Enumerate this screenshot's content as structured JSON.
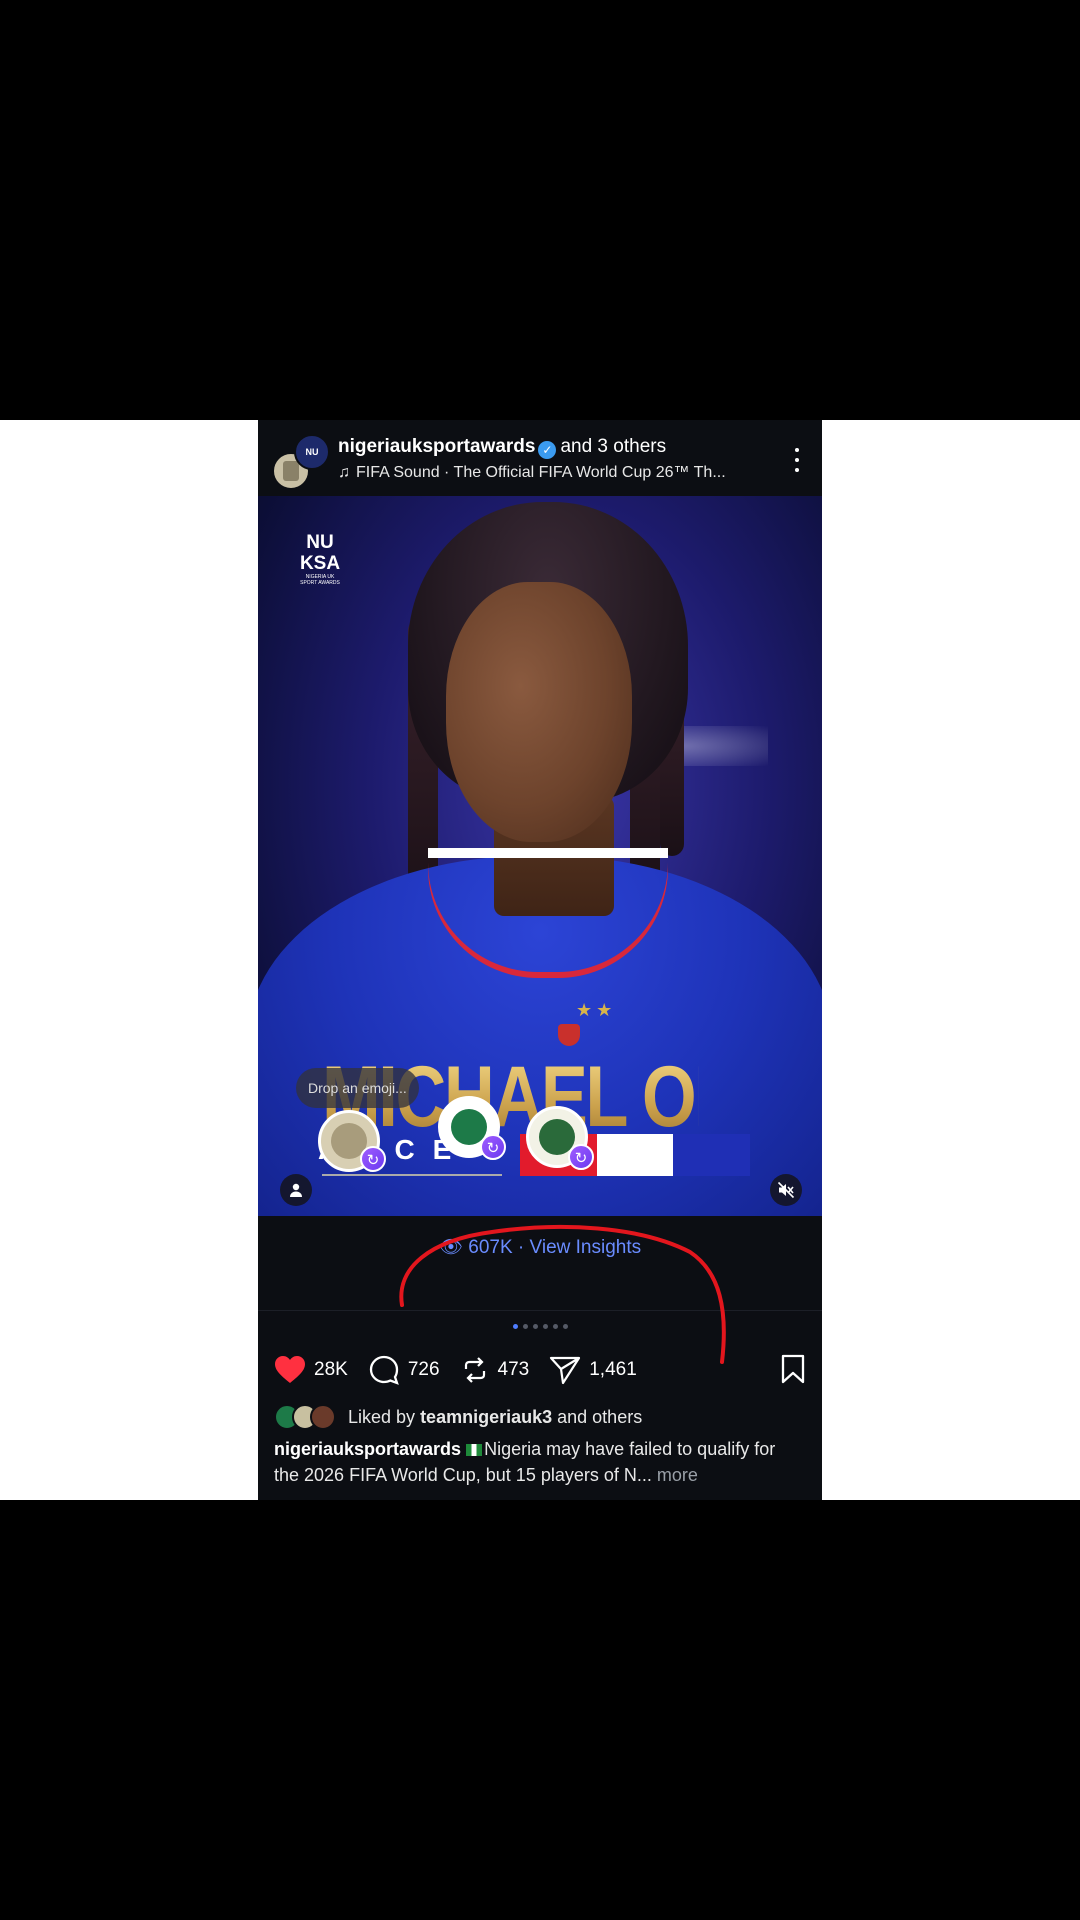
{
  "header": {
    "username": "nigeriauksportawards",
    "coauthors": "and 3 others",
    "music_text": "FIFA Sound · The Official FIFA World Cup 26™ Th...",
    "logo_text": "NU"
  },
  "post": {
    "brand_logo": "NU\nKSA",
    "player_name": "MICHAEL OLISE",
    "country_text": "ANCE",
    "emoji_placeholder": "Drop an emoji...",
    "flag_colors": [
      "#e21b2c",
      "#ffffff",
      "#1f2fb5"
    ]
  },
  "insights": {
    "views": "607K",
    "separator": "·",
    "link": "View Insights"
  },
  "carousel": {
    "count": 6,
    "active_index": 0
  },
  "actions": {
    "likes": "28K",
    "comments": "726",
    "reposts": "473",
    "shares": "1,461"
  },
  "liked_by": {
    "prefix": "Liked by",
    "user": "teamnigeriauk3",
    "suffix": "and others"
  },
  "caption": {
    "username": "nigeriauksportawards",
    "text": "Nigeria may have failed to qualify for the 2026 FIFA World Cup, but 15 players of N...",
    "more": "more"
  },
  "colors": {
    "like_red": "#ff3040",
    "link_blue": "#6a8cff",
    "verified_blue": "#3b9bf0",
    "annotation_red": "#e3161d"
  }
}
